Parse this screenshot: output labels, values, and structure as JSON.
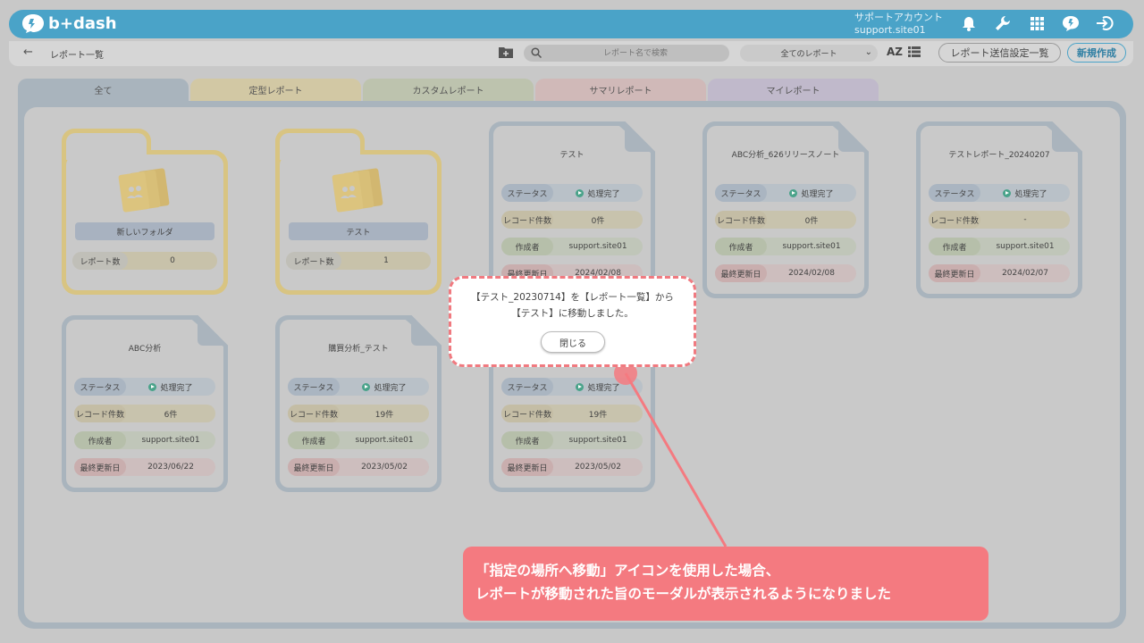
{
  "header": {
    "logo_text": "b+dash",
    "account_name": "サポートアカウント",
    "account_id": "support.site01"
  },
  "subbar": {
    "breadcrumb": "レポート一覧",
    "search_placeholder": "レポート名で検索",
    "filter_selected": "全てのレポート",
    "sort_label": "AZ",
    "send_settings_label": "レポート送信設定一覧",
    "new_label": "新規作成"
  },
  "tabs": [
    {
      "label": "全て",
      "color": "#a9b4bd"
    },
    {
      "label": "定型レポート",
      "color": "#d2c8a4"
    },
    {
      "label": "カスタムレポート",
      "color": "#bdc3ae"
    },
    {
      "label": "サマリレポート",
      "color": "#d0b9b8"
    },
    {
      "label": "マイレポート",
      "color": "#c0b9cb"
    }
  ],
  "folders": [
    {
      "name": "新しいフォルダ",
      "count_label": "レポート数",
      "count": "0"
    },
    {
      "name": "テスト",
      "count_label": "レポート数",
      "count": "1"
    }
  ],
  "row_labels": {
    "status": "ステータス",
    "records": "レコード件数",
    "author": "作成者",
    "updated": "最終更新日"
  },
  "reports": [
    {
      "title": "テスト",
      "status": "処理完了",
      "records": "0件",
      "author": "support.site01",
      "updated": "2024/02/08"
    },
    {
      "title": "ABC分析_626リリースノート",
      "status": "処理完了",
      "records": "0件",
      "author": "support.site01",
      "updated": "2024/02/08"
    },
    {
      "title": "テストレポート_20240207",
      "status": "処理完了",
      "records": "-",
      "author": "support.site01",
      "updated": "2024/02/07"
    },
    {
      "title": "ABC分析",
      "status": "処理完了",
      "records": "6件",
      "author": "support.site01",
      "updated": "2023/06/22"
    },
    {
      "title": "購買分析_テスト",
      "status": "処理完了",
      "records": "19件",
      "author": "support.site01",
      "updated": "2023/05/02"
    },
    {
      "title": "",
      "status": "処理完了",
      "records": "19件",
      "author": "support.site01",
      "updated": "2023/05/02"
    }
  ],
  "modal": {
    "line1": "【テスト_20230714】を【レポート一覧】から",
    "line2": "【テスト】に移動しました。",
    "close_label": "閉じる"
  },
  "callout": {
    "line1": "「指定の場所へ移動」アイコンを使用した場合、",
    "line2": "レポートが移動された旨のモーダルが表示されるようになりました"
  },
  "colors": {
    "brand": "#4aa3c8",
    "folder_border": "#d8c482",
    "callout": "#f47a80"
  }
}
